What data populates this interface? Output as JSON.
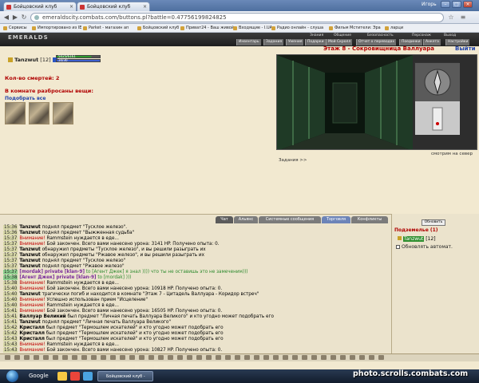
{
  "browser": {
    "tabs": [
      {
        "title": "Бойцовский клуб"
      },
      {
        "title": "Бойцовский клуб"
      }
    ],
    "window_label": "Игорь",
    "url_domain": "emeraldscity.combats.com",
    "url_path": "/buttons.pl?battle=0.47756199824825",
    "bookmarks": [
      "Сервисы",
      "Импортировано из IE",
      "Parket - магазин ап",
      "Бойцовский клуб",
      "Приват24 - Ваш живой",
      "Входящие - I.UA",
      "Радио онлайн - слуша",
      "Фильм Мстители: Эра",
      "ларци"
    ]
  },
  "game": {
    "logo": "EMERALDS",
    "menu_top": [
      "Знания",
      "Общение",
      "Безопасность",
      "Персонаж",
      "Выход"
    ],
    "menu_bottom": [
      "Инвентарь",
      "Задания",
      "Умения",
      "Подарки",
      "Мой Скролл",
      "Отчет о переводах",
      "Поединки",
      "Анкета",
      "Настройки"
    ],
    "player": {
      "name": "Tanzwut",
      "level": "[12]",
      "hp": "5025/6161",
      "mana": "30/30"
    },
    "deaths": "Кол-во смертей: 2",
    "room_items_title": "В комнате разбросаны вещи:",
    "pick_all": "Подобрать все",
    "location": "Этаж 8 - Сокровищница Валлуара",
    "exit": "Выйти",
    "look_dir": "смотрим на север",
    "tasks": "Задания >>"
  },
  "chat": {
    "tabs": [
      "Чат",
      "Альянс",
      "Системные сообщения",
      "Торговля",
      "Конфликты"
    ],
    "lines": [
      {
        "time": "15:36",
        "green": false,
        "a": "Tanzwut",
        "b": " поднял предмет \"Тусклое железо\".",
        "style": "normal"
      },
      {
        "time": "15:36",
        "green": false,
        "a": "Tanzwut",
        "b": " поднял предмет \"Выжженная судьба\"",
        "style": "normal"
      },
      {
        "time": "15:37",
        "green": false,
        "a": "Внимание!",
        "b": " Rammstein нуждается в еде...",
        "style": "warn"
      },
      {
        "time": "15:37",
        "green": false,
        "a": "Внимание!",
        "b": " Бой закончен. Всего вами нанесено урона: 3141 HP. Получено опыта: 0.",
        "style": "warn"
      },
      {
        "time": "15:37",
        "green": false,
        "a": "Tanzwut",
        "b": " обнаружил предметы \"Тусклое железо\", и вы решили разыграть их",
        "style": "normal"
      },
      {
        "time": "15:37",
        "green": false,
        "a": "Tanzwut",
        "b": " обнаружил предметы \"Ржавое железо\", и вы решили разыграть их",
        "style": "normal"
      },
      {
        "time": "15:37",
        "green": false,
        "a": "Tanzwut",
        "b": " поднял предмет \"Тусклое железо\"",
        "style": "normal"
      },
      {
        "time": "15:37",
        "green": false,
        "a": "Tanzwut",
        "b": " поднял предмет \"Ржавое железо\"",
        "style": "normal"
      },
      {
        "time": "15:37",
        "green": true,
        "a": "[mordak] private [klan-9]",
        "b": " to [Агент Джек] я знал )))) что ты не оставишь это не замеченим)))",
        "style": "private"
      },
      {
        "time": "15:38",
        "green": true,
        "a": "[Агент Джек] private [klan-9]",
        "b": " to [mordak] )))",
        "style": "private"
      },
      {
        "time": "15:38",
        "green": false,
        "a": "Внимание!",
        "b": " Rammstein нуждается в еде...",
        "style": "warn"
      },
      {
        "time": "15:40",
        "green": false,
        "a": "Внимание!",
        "b": " Бой закончен. Всего вами нанесено урона: 10918 HP. Получено опыта: 0.",
        "style": "warn"
      },
      {
        "time": "15:40",
        "green": false,
        "a": "Tanzwut",
        "b": " трагически погиб и находится в комнате \"Этаж 7 - Цитадель Валлуара - Коридор встреч\"",
        "style": "normal"
      },
      {
        "time": "15:40",
        "green": false,
        "a": "Внимание!",
        "b": " Успешно использован прием \"Исцеление\"",
        "style": "warn"
      },
      {
        "time": "15:40",
        "green": false,
        "a": "Внимание!",
        "b": " Rammstein нуждается в еде...",
        "style": "warn"
      },
      {
        "time": "15:41",
        "green": false,
        "a": "Внимание!",
        "b": " Бой закончен. Всего вами нанесено урона: 16505 HP. Получено опыта: 0.",
        "style": "warn"
      },
      {
        "time": "15:41",
        "green": false,
        "a": "Валлуар Великий",
        "b": " был предмет \"Личная печать Валлуара Великого\" и кто угодно может подобрать его",
        "style": "normal"
      },
      {
        "time": "15:41",
        "green": false,
        "a": "Tanzwut",
        "b": " поднял предмет \"Личная печать Валлуара Великого\"",
        "style": "normal"
      },
      {
        "time": "15:42",
        "green": false,
        "a": "Кристалл",
        "b": " был предмет \"Термошлем искателей\" и кто угодно может подобрать его",
        "style": "normal"
      },
      {
        "time": "15:42",
        "green": false,
        "a": "Кристалл",
        "b": " был предмет \"Термошлем искателей\" и кто угодно может подобрать его",
        "style": "normal"
      },
      {
        "time": "15:43",
        "green": false,
        "a": "Кристалл",
        "b": " был предмет \"Термошлем искателей\" и кто угодно может подобрать его",
        "style": "normal"
      },
      {
        "time": "15:43",
        "green": false,
        "a": "Внимание!",
        "b": " Rammstein нуждается в еде...",
        "style": "warn"
      },
      {
        "time": "15:43",
        "green": false,
        "a": "Внимание!",
        "b": " Бой закончен. Всего вами нанесено урона: 10827 HP. Получено опыта: 0.",
        "style": "warn"
      }
    ]
  },
  "side": {
    "refresh": "Обновить",
    "location_label": "Подземелье (1)",
    "user": "Tanzwut",
    "user_level": "[12]",
    "auto_update": "Обновлять автомат."
  },
  "taskbar": {
    "google": "Google",
    "app": "Бойцовский клуб -",
    "watermark": "photo.scrolls.combats.com"
  },
  "colors": {
    "accent_red": "#b00000",
    "link_blue": "#2244aa",
    "chat_bg": "#ebe3cc"
  }
}
